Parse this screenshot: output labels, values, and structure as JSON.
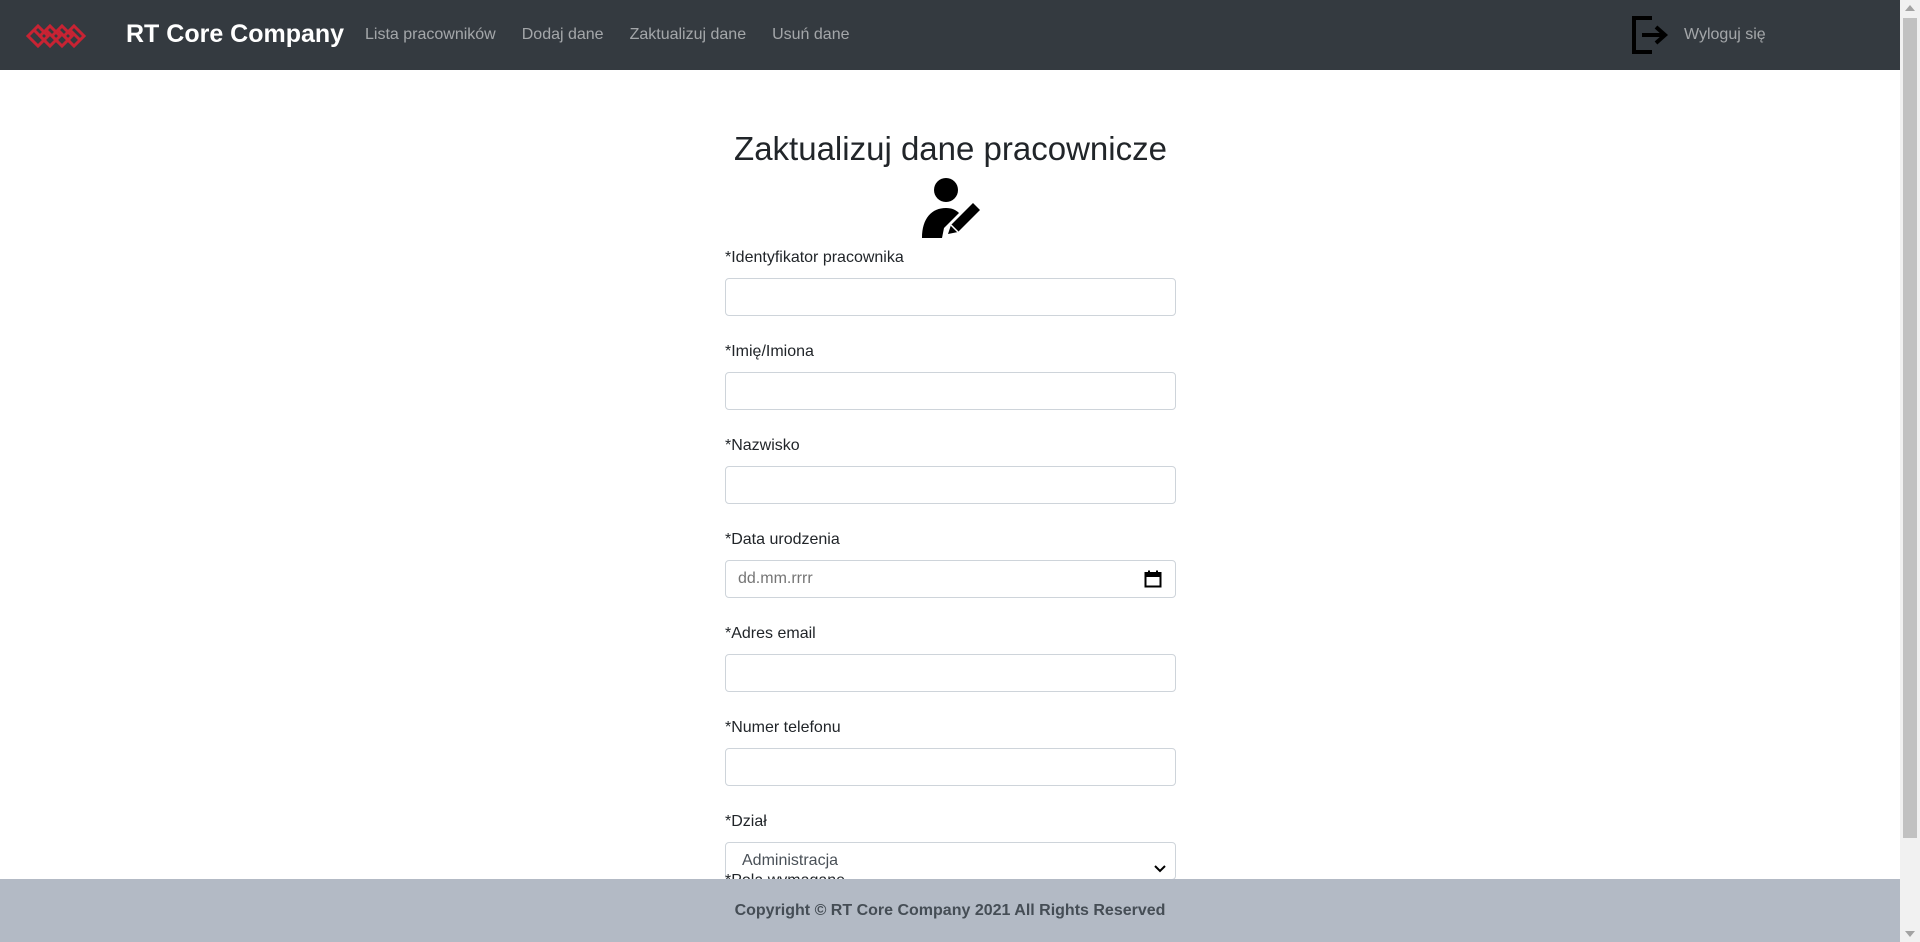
{
  "brand": {
    "name": "RT Core Company"
  },
  "nav": {
    "links": [
      {
        "label": "Lista pracowników"
      },
      {
        "label": "Dodaj dane"
      },
      {
        "label": "Zaktualizuj dane"
      },
      {
        "label": "Usuń dane"
      }
    ],
    "logout_label": "Wyloguj się"
  },
  "page": {
    "title": "Zaktualizuj dane pracownicze"
  },
  "form": {
    "fields": [
      {
        "label": "*Identyfikator pracownika",
        "value": ""
      },
      {
        "label": "*Imię/Imiona",
        "value": ""
      },
      {
        "label": "*Nazwisko",
        "value": ""
      },
      {
        "label": "*Data urodzenia",
        "placeholder": "dd.mm.rrrr"
      },
      {
        "label": "*Adres email",
        "value": ""
      },
      {
        "label": "*Numer telefonu",
        "value": ""
      },
      {
        "label": "*Dział",
        "selected": "Administracja"
      }
    ],
    "required_note": "*Pola wymagane"
  },
  "footer": {
    "text": "Copyright © RT Core Company 2021 All Rights Reserved"
  },
  "colors": {
    "navbar": "#343a40",
    "footer": "#b3bac5",
    "logo": "#c82333"
  },
  "icons": {
    "logo": "diamond-logo-icon",
    "logout": "logout-icon",
    "user": "user-edit-icon",
    "calendar": "calendar-icon",
    "chevron": "chevron-down-icon"
  }
}
